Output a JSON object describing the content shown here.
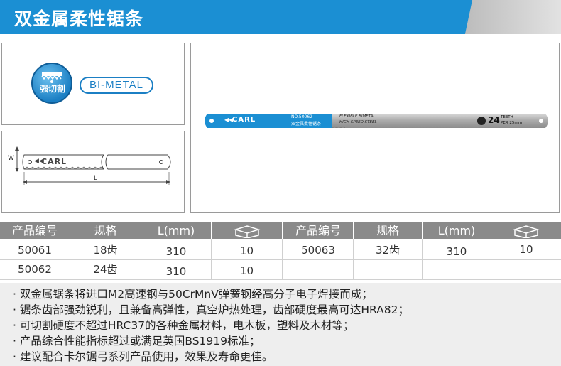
{
  "header": {
    "title": "双金属柔性锯条"
  },
  "badge": {
    "label": "强切割",
    "tag": "BI-METAL"
  },
  "diagram": {
    "brand": "CARL",
    "width_label": "W",
    "length_label": "L"
  },
  "blade_photo": {
    "brand": "CARL",
    "model": "NO.50062",
    "model_cn": "双金属柔性锯条",
    "line1": "FLEXIBLE BIMETAL",
    "line2": "HIGH SPEED STEEL",
    "teeth_count": "24",
    "teeth_label": "TEETH",
    "teeth_sub": "PER 25mm"
  },
  "table": {
    "headers": [
      "产品编号",
      "规格",
      "L(mm)",
      "box-icon"
    ],
    "left_rows": [
      [
        "50061",
        "18齿",
        "310",
        "10"
      ],
      [
        "50062",
        "24齿",
        "310",
        "10"
      ]
    ],
    "right_rows": [
      [
        "50063",
        "32齿",
        "310",
        "10"
      ]
    ]
  },
  "bullets": [
    "· 双金属锯条将进口M2高速钢与50CrMnV弹簧钢经高分子电子焊接而成；",
    "· 锯条齿部强劲锐利，且兼备高弹性，真空炉热处理，齿部硬度最高可达HRA82；",
    "· 可切割硬度不超过HRC37的各种金属材料，电木板，塑料及木材等；",
    "· 产品综合性能指标超过或满足英国BS1919标准；",
    "· 建议配合卡尔锯弓系列产品使用，效果及寿命更佳。"
  ],
  "colors": {
    "accent": "#1b8fd3",
    "header_gray": "#8a8a8a"
  }
}
